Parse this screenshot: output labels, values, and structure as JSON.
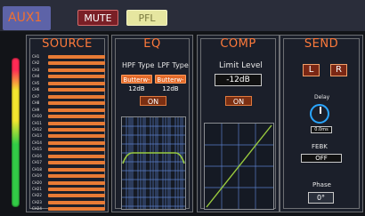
{
  "header": {
    "aux_tab": "AUX1",
    "mute": "MUTE",
    "pfl": "PFL"
  },
  "meter": {
    "level": 1.0
  },
  "source": {
    "title": "SOURCE",
    "channels": [
      {
        "label": "CH1"
      },
      {
        "label": "CH2"
      },
      {
        "label": "CH3"
      },
      {
        "label": "CH4"
      },
      {
        "label": "CH5"
      },
      {
        "label": "CH6"
      },
      {
        "label": "CH7"
      },
      {
        "label": "CH8"
      },
      {
        "label": "CH9"
      },
      {
        "label": "CH10"
      },
      {
        "label": "CH11"
      },
      {
        "label": "CH12"
      },
      {
        "label": "CH13"
      },
      {
        "label": "CH14"
      },
      {
        "label": "CH15"
      },
      {
        "label": "CH16"
      },
      {
        "label": "CH17"
      },
      {
        "label": "CH18"
      },
      {
        "label": "CH19"
      },
      {
        "label": "CH20"
      },
      {
        "label": "CH21"
      },
      {
        "label": "CH22"
      },
      {
        "label": "CH23"
      },
      {
        "label": "CH24"
      }
    ]
  },
  "eq": {
    "title": "EQ",
    "hpf_label": "HPF Type",
    "lpf_label": "LPF Type",
    "hpf_value": "Butterw-12dB",
    "lpf_value": "Butterw-12dB",
    "on_label": "ON"
  },
  "comp": {
    "title": "COMP",
    "limit_label": "Limit Level",
    "limit_value": "-12dB",
    "on_label": "ON"
  },
  "send": {
    "title": "SEND",
    "l_label": "L",
    "r_label": "R",
    "delay_label": "Delay",
    "delay_value": "0.0ms",
    "febk_label": "FEBK",
    "febk_value": "OFF",
    "phase_label": "Phase",
    "phase_value": "0°"
  },
  "colors": {
    "accent": "#ff7a3b",
    "mute_bg": "#7a1f26",
    "pfl_bg": "#e6e6a0",
    "aux_tab_bg": "#5d63a8",
    "panel_bg": "#1b1f2a",
    "graph_line": "#9acb3e",
    "grid_line": "#5a7ec8"
  }
}
